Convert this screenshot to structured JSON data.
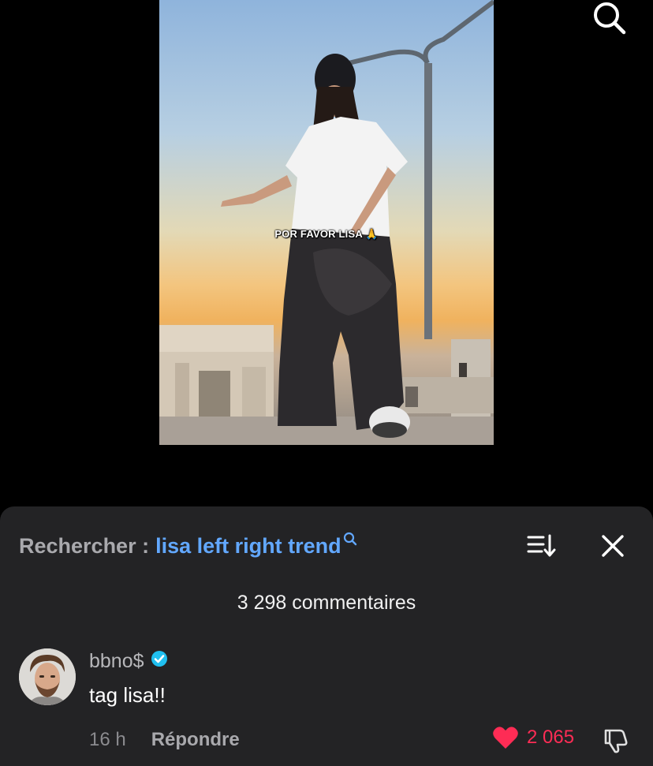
{
  "video": {
    "caption": "POR FAVOR LISA 🙏"
  },
  "top_bar": {
    "search_icon": "search-icon"
  },
  "comments_sheet": {
    "search_prefix": "Rechercher :",
    "search_term": "lisa left right trend",
    "sort_icon": "sort-icon",
    "close_icon": "close-icon",
    "comment_count": "3 298 commentaires",
    "comments": [
      {
        "username": "bbno$",
        "verified": true,
        "text": "tag lisa!!",
        "time": "16 h",
        "reply_label": "Répondre",
        "likes": "2 065",
        "liked": true
      }
    ]
  },
  "colors": {
    "sheet_bg": "#232325",
    "accent_blue": "#62a8ff",
    "like_red": "#fe2c55",
    "verified_blue": "#20c0f0"
  }
}
